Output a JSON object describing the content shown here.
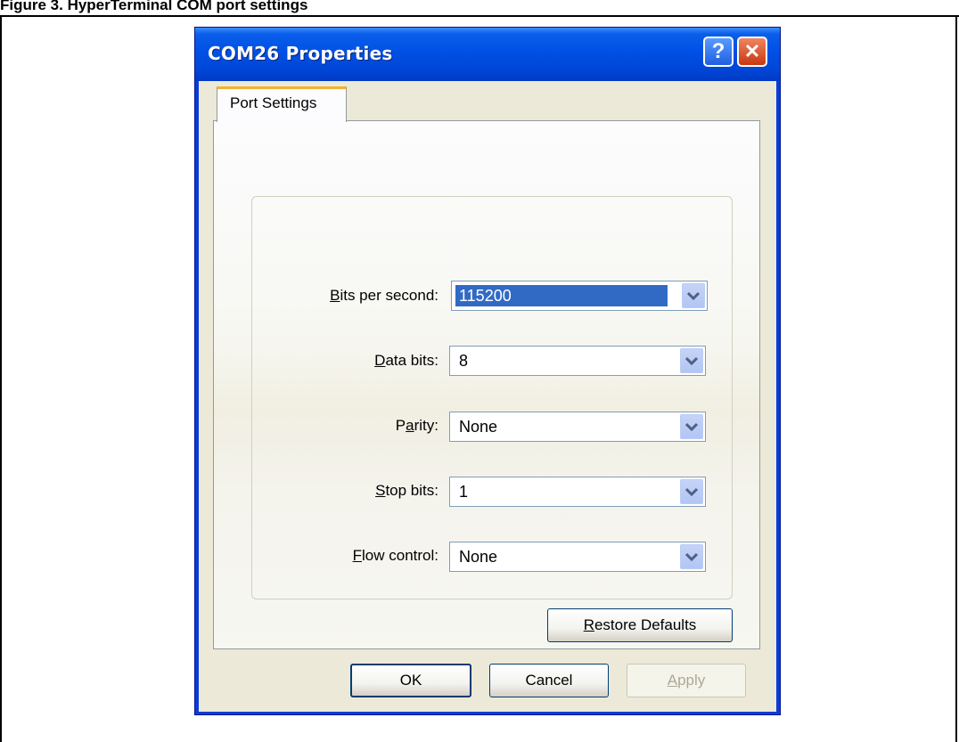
{
  "caption": "Figure 3. HyperTerminal COM port settings",
  "window": {
    "title": "COM26 Properties",
    "help_glyph": "?",
    "close_glyph": "✕"
  },
  "tab": {
    "label": "Port Settings"
  },
  "fields": {
    "bits_per_second": {
      "label_hot": "B",
      "label_rest": "its per second:",
      "value": "115200"
    },
    "data_bits": {
      "label_hot": "D",
      "label_rest": "ata bits:",
      "value": "8"
    },
    "parity": {
      "label_pre": "P",
      "label_hot": "a",
      "label_rest": "rity:",
      "value": "None"
    },
    "stop_bits": {
      "label_hot": "S",
      "label_rest": "top bits:",
      "value": "1"
    },
    "flow_control": {
      "label_hot": "F",
      "label_rest": "low control:",
      "value": "None"
    }
  },
  "buttons": {
    "restore_hot": "R",
    "restore_rest": "estore Defaults",
    "ok": "OK",
    "cancel": "Cancel",
    "apply_hot": "A",
    "apply_rest": "pply"
  },
  "icons": {
    "combo_arrow": "chevron-down-icon",
    "help": "help-icon",
    "close": "close-icon"
  },
  "colors": {
    "titlebar": "#0050e5",
    "selection": "#316ac5",
    "tab_highlight": "#f0b232",
    "dialog_face": "#ece9d8"
  }
}
